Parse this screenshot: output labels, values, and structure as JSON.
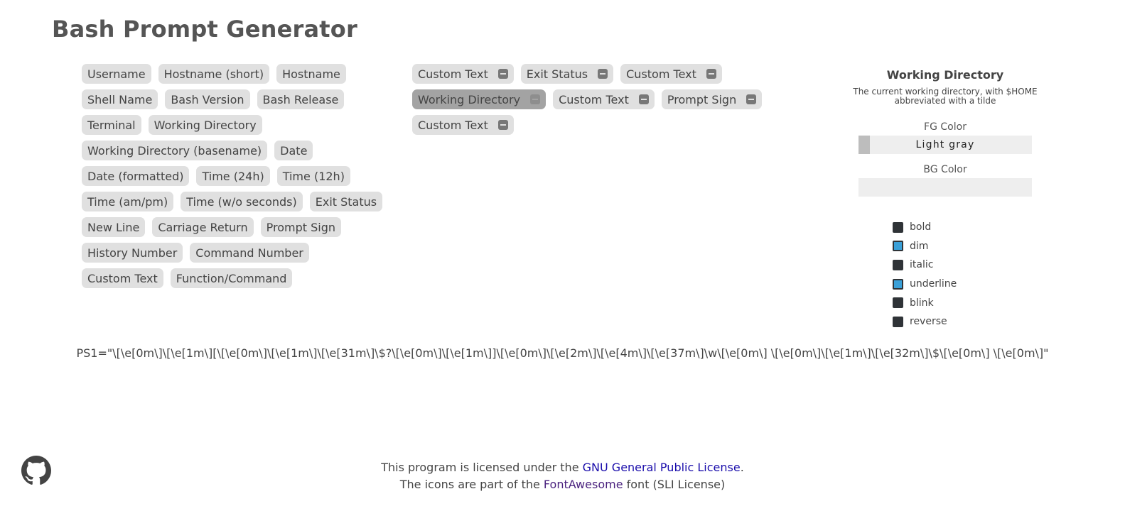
{
  "title": "Bash Prompt Generator",
  "palette_rows": [
    [
      "Username",
      "Hostname (short)",
      "Hostname"
    ],
    [
      "Shell Name",
      "Bash Version",
      "Bash Release"
    ],
    [
      "Terminal",
      "Working Directory"
    ],
    [
      "Working Directory (basename)",
      "Date"
    ],
    [
      "Date (formatted)",
      "Time (24h)",
      "Time (12h)"
    ],
    [
      "Time (am/pm)",
      "Time (w/o seconds)",
      "Exit Status"
    ],
    [
      "New Line",
      "Carriage Return",
      "Prompt Sign"
    ],
    [
      "History Number",
      "Command Number"
    ],
    [
      "Custom Text",
      "Function/Command"
    ]
  ],
  "builder_rows": [
    [
      "Custom Text",
      "Exit Status",
      "Custom Text"
    ],
    [
      "Working Directory",
      "Custom Text",
      "Prompt Sign"
    ],
    [
      "Custom Text"
    ]
  ],
  "selected_element": "Working Directory",
  "properties": {
    "title": "Working Directory",
    "description": "The current working directory, with $HOME abbreviated with a tilde",
    "fg_label": "FG Color",
    "fg_value": "Light gray",
    "fg_swatch": "#bdbdbd",
    "bg_label": "BG Color",
    "bg_value": "",
    "checkboxes": [
      {
        "label": "bold",
        "checked": false
      },
      {
        "label": "dim",
        "checked": true
      },
      {
        "label": "italic",
        "checked": false
      },
      {
        "label": "underline",
        "checked": true
      },
      {
        "label": "blink",
        "checked": false
      },
      {
        "label": "reverse",
        "checked": false
      }
    ]
  },
  "ps1": "PS1=\"\\[\\e[0m\\]\\[\\e[1m\\][\\[\\e[0m\\]\\[\\e[1m\\]\\[\\e[31m\\]\\$?\\[\\e[0m\\]\\[\\e[1m\\]]\\[\\e[0m\\]\\[\\e[2m\\]\\[\\e[4m\\]\\[\\e[37m\\]\\w\\[\\e[0m\\] \\[\\e[0m\\]\\[\\e[1m\\]\\[\\e[32m\\]\\$\\[\\e[0m\\] \\[\\e[0m\\]\"",
  "footer": {
    "line1_prefix": "This program is licensed under the ",
    "line1_link": "GNU General Public License",
    "line1_suffix": ".",
    "line2_prefix": "The icons are part of the ",
    "line2_link": "FontAwesome",
    "line2_suffix": " font (SLI License)"
  },
  "icons": {
    "github": "github-icon",
    "remove": "minus-icon"
  }
}
